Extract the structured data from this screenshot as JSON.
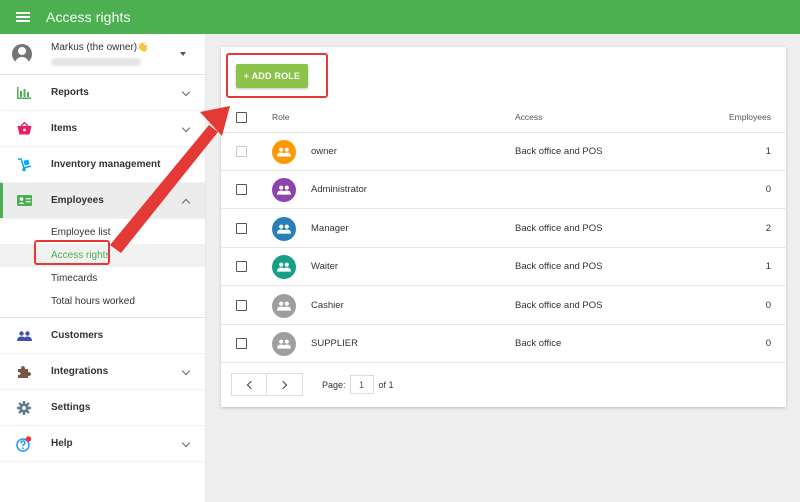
{
  "header": {
    "title": "Access rights"
  },
  "account": {
    "name": "Markus (the owner)",
    "hand_emoji": "👋"
  },
  "sidebar": {
    "items": [
      {
        "label": "Reports"
      },
      {
        "label": "Items"
      },
      {
        "label": "Inventory management"
      },
      {
        "label": "Employees"
      },
      {
        "label": "Customers"
      },
      {
        "label": "Integrations"
      },
      {
        "label": "Settings"
      },
      {
        "label": "Help"
      }
    ],
    "employees_sub": [
      {
        "label": "Employee list"
      },
      {
        "label": "Access rights"
      },
      {
        "label": "Timecards"
      },
      {
        "label": "Total hours worked"
      }
    ]
  },
  "main": {
    "add_role_label": "+ ADD ROLE",
    "columns": {
      "role": "Role",
      "access": "Access",
      "employees": "Employees"
    },
    "rows": [
      {
        "role": "owner",
        "access": "Back office and POS",
        "employees": "1",
        "color": "#ff9800"
      },
      {
        "role": "Administrator",
        "access": "",
        "employees": "0",
        "color": "#8e44ad"
      },
      {
        "role": "Manager",
        "access": "Back office and POS",
        "employees": "2",
        "color": "#2980b9"
      },
      {
        "role": "Waiter",
        "access": "Back office and POS",
        "employees": "1",
        "color": "#16a085"
      },
      {
        "role": "Cashier",
        "access": "Back office and POS",
        "employees": "0",
        "color": "#9e9e9e"
      },
      {
        "role": "SUPPLIER",
        "access": "Back office",
        "employees": "0",
        "color": "#9e9e9e"
      }
    ],
    "pagination": {
      "page_label": "Page:",
      "current": "1",
      "of": "of 1"
    }
  },
  "colors": {
    "brand_green": "#4caf50",
    "button_green": "#8bc34a",
    "highlight_red": "#e53935"
  }
}
